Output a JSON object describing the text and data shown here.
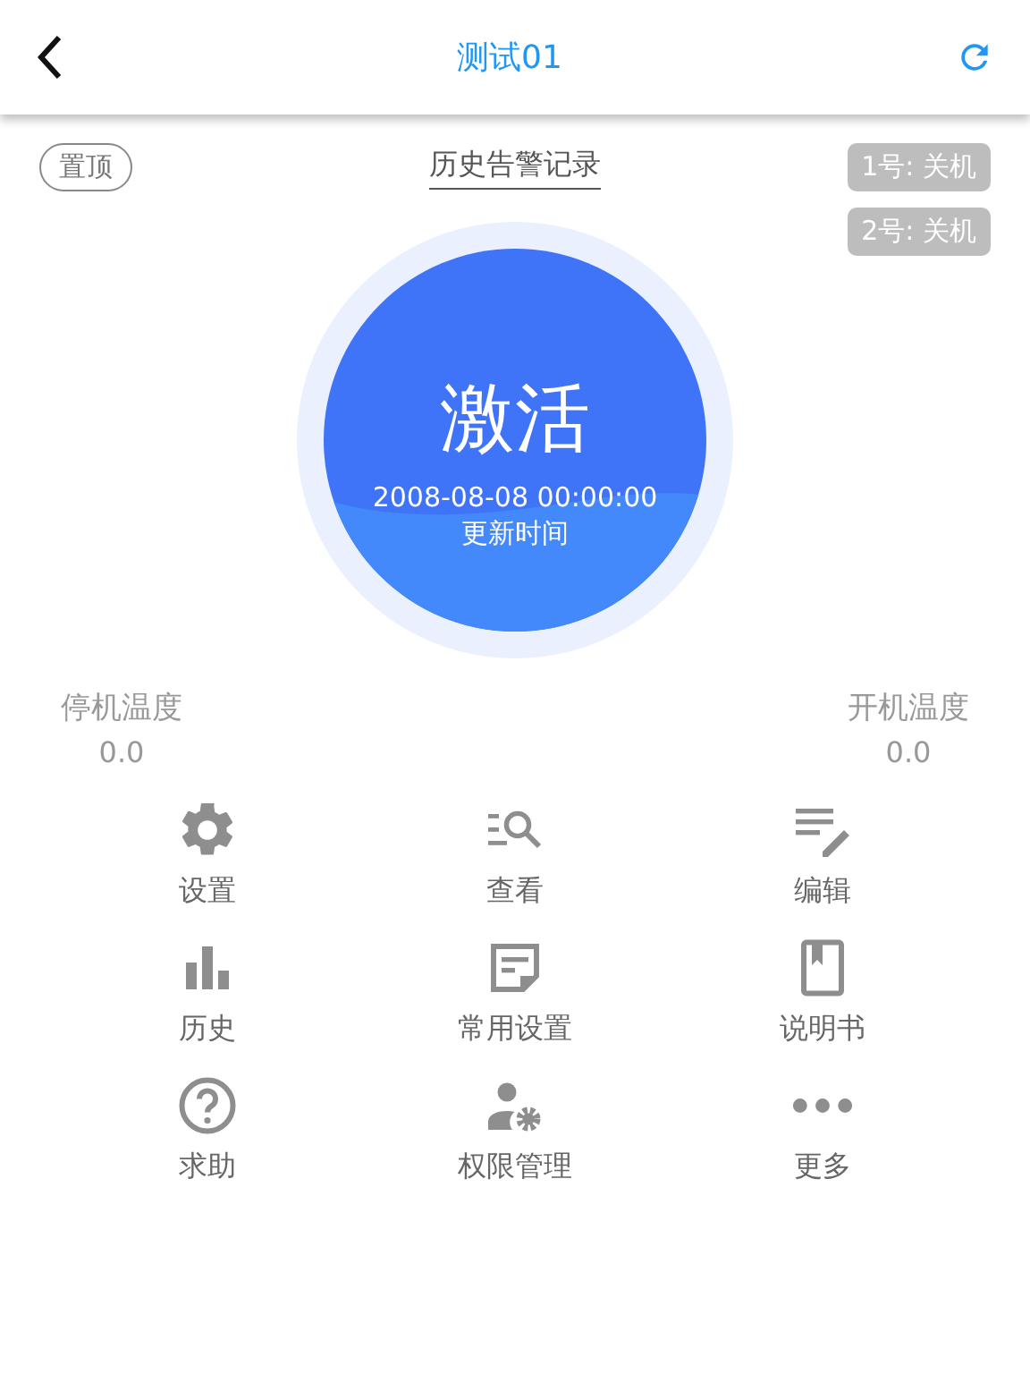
{
  "header": {
    "title": "测试01"
  },
  "pin_button": {
    "label": "置顶"
  },
  "history_link": {
    "label": "历史告警记录"
  },
  "status_tags": [
    {
      "label": "1号: 关机"
    },
    {
      "label": "2号: 关机"
    }
  ],
  "status_circle": {
    "state": "激活",
    "timestamp": "2008-08-08 00:00:00",
    "caption": "更新时间"
  },
  "temperatures": [
    {
      "label": "停机温度",
      "value": "0.0"
    },
    {
      "label": "开机温度",
      "value": "0.0"
    }
  ],
  "menu": [
    {
      "kind": "settings",
      "label": "设置"
    },
    {
      "kind": "search",
      "label": "查看"
    },
    {
      "kind": "edit",
      "label": "编辑"
    },
    {
      "kind": "chart",
      "label": "历史"
    },
    {
      "kind": "note",
      "label": "常用设置"
    },
    {
      "kind": "book",
      "label": "说明书"
    },
    {
      "kind": "help",
      "label": "求助"
    },
    {
      "kind": "user-gear",
      "label": "权限管理"
    },
    {
      "kind": "more",
      "label": "更多"
    }
  ]
}
